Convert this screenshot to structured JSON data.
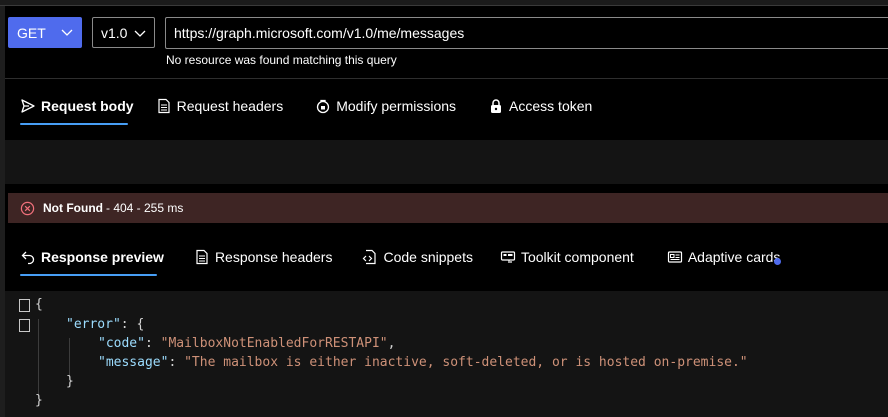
{
  "query": {
    "method": "GET",
    "version": "v1.0",
    "url": "https://graph.microsoft.com/v1.0/me/messages",
    "url_message": "No resource was found matching this query"
  },
  "request_tabs": [
    {
      "label": "Request body",
      "icon": "send-icon",
      "active": true
    },
    {
      "label": "Request headers",
      "icon": "document-icon",
      "active": false
    },
    {
      "label": "Modify permissions",
      "icon": "shield-lock-icon",
      "active": false
    },
    {
      "label": "Access token",
      "icon": "lock-icon",
      "active": false
    }
  ],
  "status": {
    "label": "Not Found",
    "detail": "- 404 - 255 ms",
    "color": "#3e2524"
  },
  "response_tabs": [
    {
      "label": "Response preview",
      "icon": "arrow-undo-icon",
      "active": true
    },
    {
      "label": "Response headers",
      "icon": "document-icon",
      "active": false
    },
    {
      "label": "Code snippets",
      "icon": "code-document-icon",
      "active": false
    },
    {
      "label": "Toolkit component",
      "icon": "toolkit-icon",
      "active": false
    },
    {
      "label": "Adaptive cards",
      "icon": "card-icon",
      "active": false
    }
  ],
  "response": {
    "open_brace": "{",
    "error_key": "\"error\"",
    "code_key": "\"code\"",
    "code_value": "\"MailboxNotEnabledForRESTAPI\"",
    "message_key": "\"message\"",
    "message_value": "\"The mailbox is either inactive, soft-deleted, or is hosted on-premise.\"",
    "close_inner": "}",
    "close_outer": "}"
  },
  "colors": {
    "accent": "#4f6bed",
    "tab_underline": "#479ef5",
    "json_key": "#9cdcfe",
    "json_string": "#ce9178"
  }
}
